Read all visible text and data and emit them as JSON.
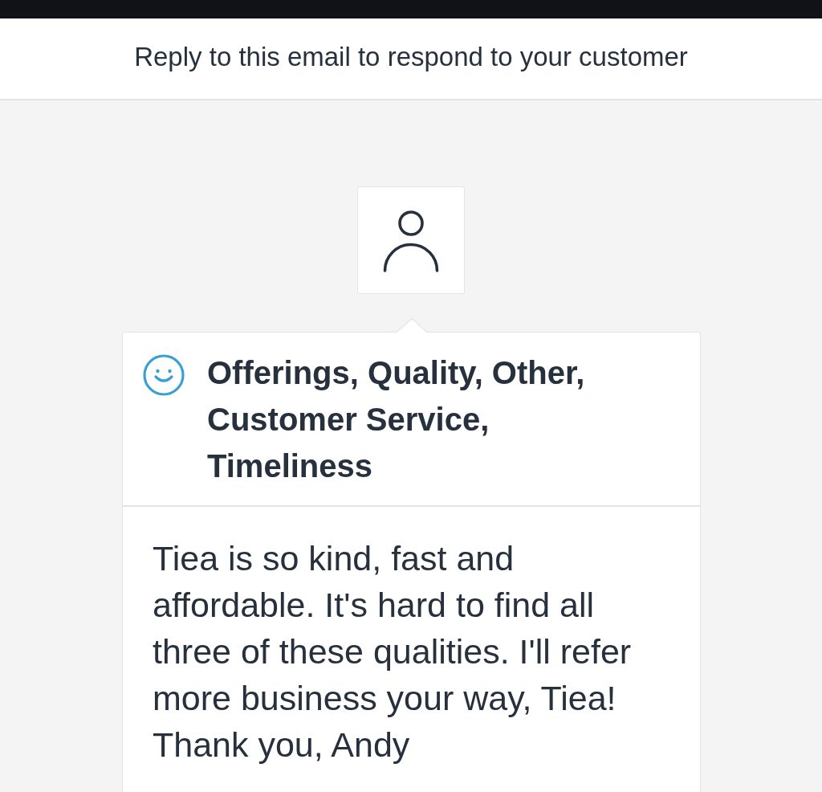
{
  "banner": {
    "text": "Reply to this email to respond to your customer"
  },
  "feedback_card": {
    "positive": true,
    "categories": "Offerings, Quality, Other, Customer Service, Timeliness",
    "comment": "Tiea is so kind, fast and affordable. It's hard to find all three of these qualities. I'll refer more business your way, Tiea! Thank you, Andy"
  }
}
